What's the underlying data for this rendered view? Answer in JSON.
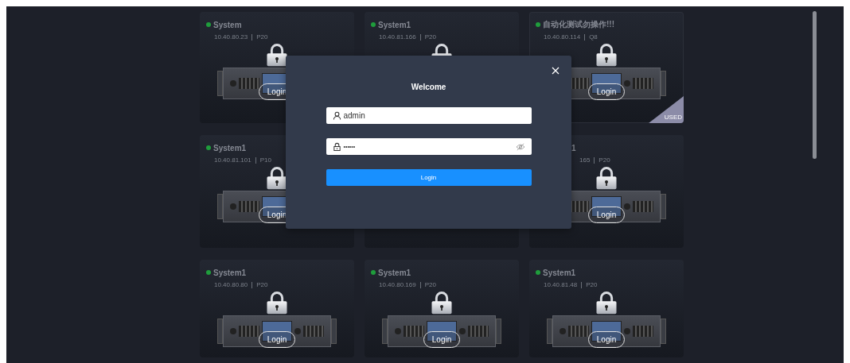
{
  "cards": [
    {
      "kind": "clipped",
      "title": "System",
      "ip": "10.40.80.23",
      "model": "P20",
      "online": true,
      "login": "Login",
      "used": false
    },
    {
      "kind": "plain",
      "title": "System1",
      "ip": "10.40.81.166",
      "model": "P20",
      "online": true,
      "used": false
    },
    {
      "kind": "plain",
      "title": "自动化测试勿操作!!!",
      "ip": "10.40.80.114",
      "model": "Q8",
      "online": true,
      "login": "Login",
      "used": true,
      "used_label": "USED"
    },
    {
      "kind": "clipped",
      "title": "System1",
      "ip": "10.40.81.101",
      "model": "P10",
      "online": true,
      "login": "Login",
      "used": false
    },
    {
      "kind": "hidden",
      "used": false
    },
    {
      "kind": "shifted",
      "title": "1",
      "ip": "165",
      "model": "P20",
      "login": "Login",
      "used": false
    },
    {
      "kind": "plain",
      "title": "System1",
      "ip": "10.40.80.80",
      "model": "P20",
      "online": true,
      "login": "Login",
      "used": false
    },
    {
      "kind": "plain",
      "title": "System1",
      "ip": "10.40.80.169",
      "model": "P20",
      "online": true,
      "login": "Login",
      "used": false
    },
    {
      "kind": "plain",
      "title": "System1",
      "ip": "10.40.81.48",
      "model": "P20",
      "online": true,
      "login": "Login",
      "used": false
    }
  ],
  "dialog": {
    "title": "Welcome",
    "username": "admin",
    "password": "••••••",
    "button": "Login"
  }
}
